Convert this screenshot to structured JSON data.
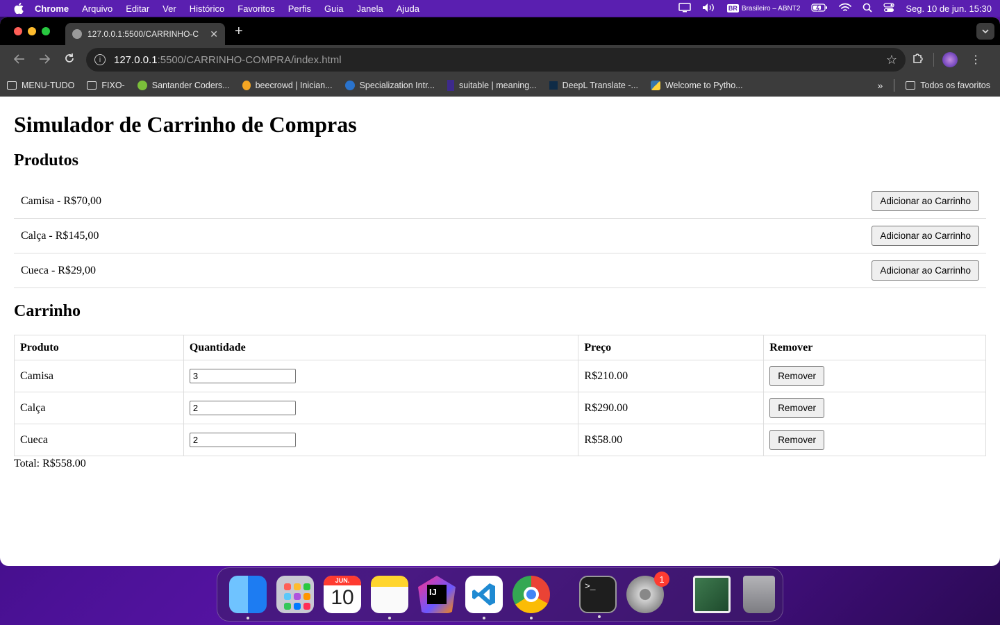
{
  "menubar": {
    "app": "Chrome",
    "items": [
      "Arquivo",
      "Editar",
      "Ver",
      "Histórico",
      "Favoritos",
      "Perfis",
      "Guia",
      "Janela",
      "Ajuda"
    ],
    "keyboard_flag": "BR",
    "keyboard_label": "Brasileiro – ABNT2",
    "clock": "Seg. 10 de jun.  15:30"
  },
  "tab": {
    "title": "127.0.0.1:5500/CARRINHO-C",
    "close": "✕",
    "newtab": "+"
  },
  "address": {
    "host": "127.0.0.1",
    "path": ":5500/CARRINHO-COMPRA/index.html"
  },
  "bookmarks": [
    {
      "label": "MENU-TUDO",
      "icon": "folder-icon"
    },
    {
      "label": "FIXO-",
      "icon": "folder-icon"
    },
    {
      "label": "Santander Coders...",
      "icon": "santander-icon"
    },
    {
      "label": "beecrowd | Inician...",
      "icon": "beecrowd-icon"
    },
    {
      "label": "Specialization Intr...",
      "icon": "coursera-icon"
    },
    {
      "label": "suitable | meaning...",
      "icon": "dictionary-icon"
    },
    {
      "label": "DeepL Translate -...",
      "icon": "deepl-icon"
    },
    {
      "label": "Welcome to Pytho...",
      "icon": "python-icon"
    }
  ],
  "bookmarks_all": "Todos os favoritos",
  "page": {
    "title": "Simulador de Carrinho de Compras",
    "products_heading": "Produtos",
    "products": [
      {
        "label": "Camisa - R$70,00",
        "button": "Adicionar ao Carrinho"
      },
      {
        "label": "Calça - R$145,00",
        "button": "Adicionar ao Carrinho"
      },
      {
        "label": "Cueca - R$29,00",
        "button": "Adicionar ao Carrinho"
      }
    ],
    "cart_heading": "Carrinho",
    "cart_headers": [
      "Produto",
      "Quantidade",
      "Preço",
      "Remover"
    ],
    "cart_rows": [
      {
        "product": "Camisa",
        "quantity": "3",
        "price": "R$210.00",
        "remove": "Remover"
      },
      {
        "product": "Calça",
        "quantity": "2",
        "price": "R$290.00",
        "remove": "Remover"
      },
      {
        "product": "Cueca",
        "quantity": "2",
        "price": "R$58.00",
        "remove": "Remover"
      }
    ],
    "total": "Total: R$558.00"
  },
  "dock": {
    "calendar_month": "JUN.",
    "calendar_day": "10",
    "settings_badge": "1",
    "terminal_prompt": ">_",
    "intellij_label": "IJ"
  }
}
